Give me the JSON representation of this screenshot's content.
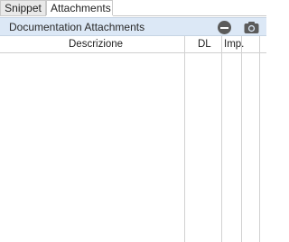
{
  "tabs": [
    {
      "label": "Snippet",
      "active": false
    },
    {
      "label": "Attachments",
      "active": true
    }
  ],
  "panel": {
    "title": "Documentation Attachments",
    "actions": [
      {
        "icon": "minus-circle-icon"
      },
      {
        "icon": "camera-icon"
      }
    ]
  },
  "table": {
    "columns": [
      "Descrizione",
      "DL",
      "Imp.",
      "",
      ""
    ],
    "rows": []
  },
  "colors": {
    "header_bg": "#dce8f6",
    "tab_inactive_bg": "#e9e9e9",
    "icon_gray": "#5b5b5b"
  }
}
